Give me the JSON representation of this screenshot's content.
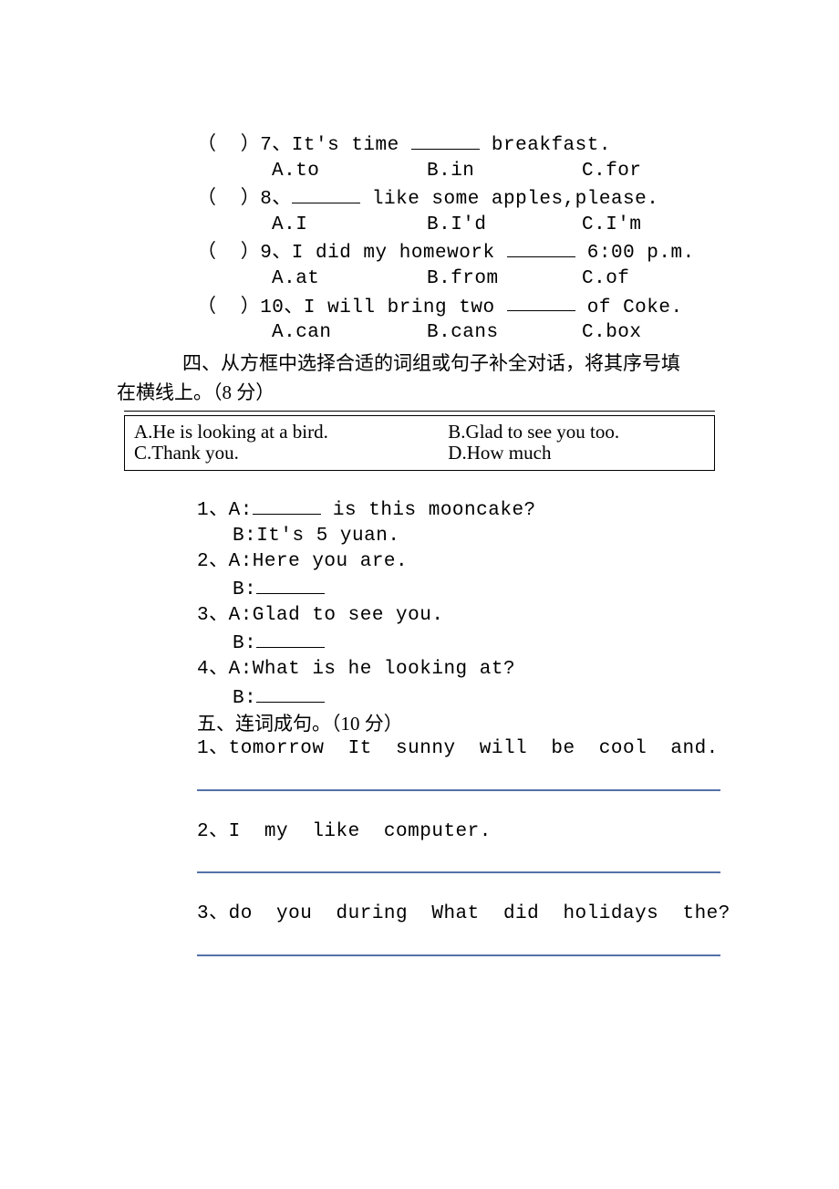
{
  "q7": {
    "stem_prefix": "（  ）7、It's time ",
    "stem_suffix": " breakfast.",
    "optA": "A.to",
    "optB": "B.in",
    "optC": "C.for"
  },
  "q8": {
    "stem_prefix": "（  ）8、",
    "stem_suffix": " like some apples,please.",
    "optA": "A.I",
    "optB": "B.I'd",
    "optC": "C.I'm"
  },
  "q9": {
    "stem_prefix": "（  ）9、I did my homework ",
    "stem_suffix": " 6:00 p.m.",
    "optA": "A.at",
    "optB": "B.from",
    "optC": "C.of"
  },
  "q10": {
    "stem_prefix": "（  ）10、I will bring two ",
    "stem_suffix": " of Coke.",
    "optA": "A.can",
    "optB": "B.cans",
    "optC": "C.box"
  },
  "section4_title_a": "四、从方框中选择合适的词组或句子补全对话，将其序号填",
  "section4_title_b": "在横线上。（8 分）",
  "box": {
    "A": "A.He is looking at a bird.",
    "B": "B.Glad to see you too.",
    "C": "C.Thank you.",
    "D": "D.How much"
  },
  "d1": {
    "a_prefix": "1、A:",
    "a_suffix": " is this mooncake?",
    "b": "B:It's 5 yuan."
  },
  "d2": {
    "a": "2、A:Here you are.",
    "b": "B:"
  },
  "d3": {
    "a": "3、A:Glad to see you.",
    "b": "B:"
  },
  "d4": {
    "a": "4、A:What is he looking at?",
    "b": "B:"
  },
  "section5_title": "五、连词成句。（10 分）",
  "s5_1": "1、tomorrow  It  sunny  will  be  cool  and.",
  "s5_2": "2、I  my  like  computer.",
  "s5_3": "3、do  you  during  What  did  holidays  the?"
}
